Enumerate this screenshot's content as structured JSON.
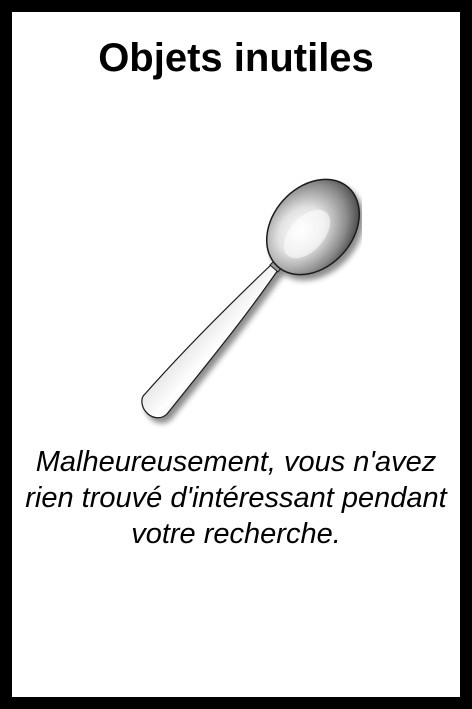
{
  "card": {
    "title": "Objets inutiles",
    "text": "Malheureusement, vous n'avez rien trouvé d'intéressant pendant votre recherche.",
    "illustration": "spoon-icon",
    "colors": {
      "border": "#000000",
      "background": "#ffffff",
      "text": "#000000"
    }
  }
}
